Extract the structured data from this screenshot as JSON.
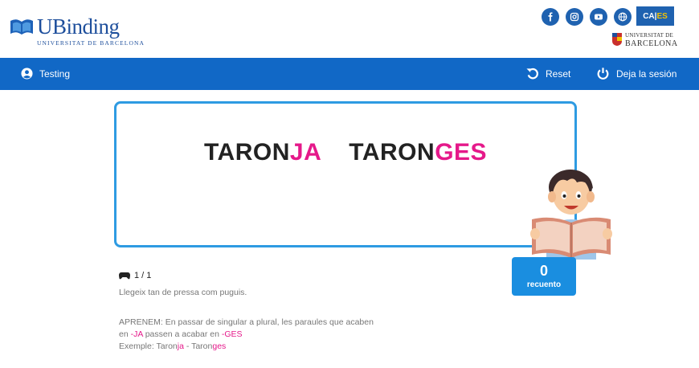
{
  "brand": {
    "name": "UBinding",
    "subtitle": "UNIVERSITAT DE BARCELONA",
    "partner_line1": "UNIVERSITAT DE",
    "partner_line2": "BARCELONA",
    "primary_color": "#1168c6"
  },
  "social": [
    {
      "name": "facebook-icon"
    },
    {
      "name": "instagram-icon"
    },
    {
      "name": "youtube-icon"
    },
    {
      "name": "globe-icon"
    }
  ],
  "language": {
    "ca": "CA",
    "separator": "|",
    "es": "ES"
  },
  "nav": {
    "user": "Testing",
    "reset": "Reset",
    "logout": "Deja la sesión"
  },
  "exercise": {
    "word1_base": "TARON",
    "word1_end": "JA",
    "word2_base": "TARON",
    "word2_end": "GES",
    "highlight_color": "#e5198a"
  },
  "counter": {
    "value": "0",
    "label": "recuento"
  },
  "progress": "1 / 1",
  "instruction": "Llegeix tan de pressa com puguis.",
  "learn": {
    "line1": "APRENEM: En passar de singular a plural, les paraules que acaben",
    "line2_a": "en ",
    "line2_b": "-JA",
    "line2_c": " passen a acabar en ",
    "line2_d": "-GES",
    "line3_a": "Exemple: Taron",
    "line3_b": "ja",
    "line3_c": " - Taron",
    "line3_d": "ges"
  }
}
